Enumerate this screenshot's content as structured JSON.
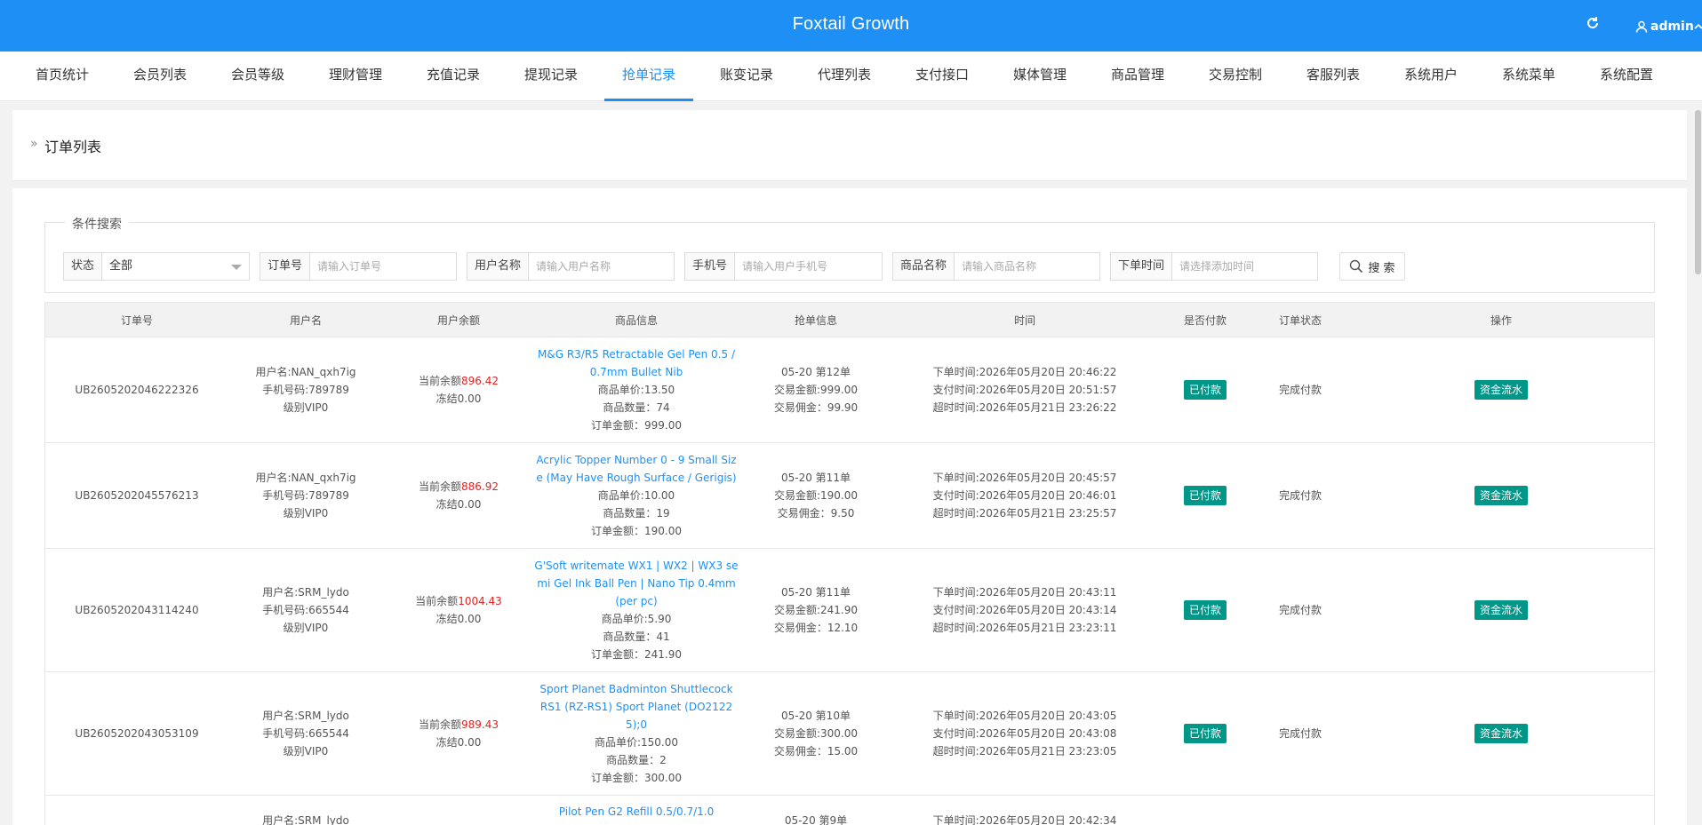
{
  "app": {
    "title": "Foxtail Growth",
    "user": "admin"
  },
  "nav": [
    {
      "label": "首页统计"
    },
    {
      "label": "会员列表"
    },
    {
      "label": "会员等级"
    },
    {
      "label": "理财管理"
    },
    {
      "label": "充值记录"
    },
    {
      "label": "提现记录"
    },
    {
      "label": "抢单记录",
      "active": true
    },
    {
      "label": "账变记录"
    },
    {
      "label": "代理列表"
    },
    {
      "label": "支付接口"
    },
    {
      "label": "媒体管理"
    },
    {
      "label": "商品管理"
    },
    {
      "label": "交易控制"
    },
    {
      "label": "客服列表"
    },
    {
      "label": "系统用户"
    },
    {
      "label": "系统菜单"
    },
    {
      "label": "系统配置"
    }
  ],
  "page": {
    "chevron": "»",
    "title": "订单列表"
  },
  "search": {
    "legend": "条件搜索",
    "status_label": "状态",
    "status_value": "全部",
    "order_label": "订单号",
    "order_placeholder": "请输入订单号",
    "username_label": "用户名称",
    "username_placeholder": "请输入用户名称",
    "phone_label": "手机号",
    "phone_placeholder": "请输入用户手机号",
    "goods_label": "商品名称",
    "goods_placeholder": "请输入商品名称",
    "time_label": "下单时间",
    "time_placeholder": "请选择添加时间",
    "button": "搜 索"
  },
  "table": {
    "headers": [
      "订单号",
      "用户名",
      "用户余额",
      "商品信息",
      "抢单信息",
      "时间",
      "是否付款",
      "订单状态",
      "操作"
    ],
    "rows": [
      {
        "order_no": "UB2605202046222326",
        "username": "用户名:NAN_qxh7ig",
        "phone": "手机号码:789789",
        "level": "级别VIP0",
        "balance_prefix": "当前余额",
        "balance": "896.42",
        "frozen": "冻结0.00",
        "goods_name_1": "M&G R3/R5 Retractable Gel Pen 0.5 /",
        "goods_name_2": "0.7mm Bullet Nib",
        "goods_name_3": "",
        "unit_price": "商品单价:13.50",
        "quantity": "商品数量：74",
        "amount": "订单金额：999.00",
        "grab_1": "05-20 第12单",
        "grab_2": "交易金额:999.00",
        "grab_3": "交易佣金：99.90",
        "time_order": "下单时间:2026年05月20日 20:46:22",
        "time_pay": "支付时间:2026年05月20日 20:51:57",
        "time_expire": "超时时间:2026年05月21日 23:26:22",
        "paid": "已付款",
        "status": "完成付款",
        "action": "资金流水"
      },
      {
        "order_no": "UB2605202045576213",
        "username": "用户名:NAN_qxh7ig",
        "phone": "手机号码:789789",
        "level": "级别VIP0",
        "balance_prefix": "当前余额",
        "balance": "886.92",
        "frozen": "冻结0.00",
        "goods_name_1": "Acrylic Topper Number 0 - 9 Small Siz",
        "goods_name_2": "e (May Have Rough Surface / Gerigis)",
        "goods_name_3": "",
        "unit_price": "商品单价:10.00",
        "quantity": "商品数量：19",
        "amount": "订单金额：190.00",
        "grab_1": "05-20 第11单",
        "grab_2": "交易金额:190.00",
        "grab_3": "交易佣金：9.50",
        "time_order": "下单时间:2026年05月20日 20:45:57",
        "time_pay": "支付时间:2026年05月20日 20:46:01",
        "time_expire": "超时时间:2026年05月21日 23:25:57",
        "paid": "已付款",
        "status": "完成付款",
        "action": "资金流水"
      },
      {
        "order_no": "UB2605202043114240",
        "username": "用户名:SRM_lydo",
        "phone": "手机号码:665544",
        "level": "级别VIP0",
        "balance_prefix": "当前余额",
        "balance": "1004.43",
        "frozen": "冻结0.00",
        "goods_name_1": "G'Soft writemate WX1 | WX2 | WX3 se",
        "goods_name_2": "mi Gel Ink Ball Pen | Nano Tip 0.4mm",
        "goods_name_3": "(per pc)",
        "unit_price": "商品单价:5.90",
        "quantity": "商品数量：41",
        "amount": "订单金额：241.90",
        "grab_1": "05-20 第11单",
        "grab_2": "交易金额:241.90",
        "grab_3": "交易佣金：12.10",
        "time_order": "下单时间:2026年05月20日 20:43:11",
        "time_pay": "支付时间:2026年05月20日 20:43:14",
        "time_expire": "超时时间:2026年05月21日 23:23:11",
        "paid": "已付款",
        "status": "完成付款",
        "action": "资金流水"
      },
      {
        "order_no": "UB2605202043053109",
        "username": "用户名:SRM_lydo",
        "phone": "手机号码:665544",
        "level": "级别VIP0",
        "balance_prefix": "当前余额",
        "balance": "989.43",
        "frozen": "冻结0.00",
        "goods_name_1": "Sport Planet Badminton Shuttlecock",
        "goods_name_2": "RS1 (RZ-RS1) Sport Planet (DO2122",
        "goods_name_3": "5);0",
        "unit_price": "商品单价:150.00",
        "quantity": "商品数量：2",
        "amount": "订单金额：300.00",
        "grab_1": "05-20 第10单",
        "grab_2": "交易金额:300.00",
        "grab_3": "交易佣金：15.00",
        "time_order": "下单时间:2026年05月20日 20:43:05",
        "time_pay": "支付时间:2026年05月20日 20:43:08",
        "time_expire": "超时时间:2026年05月21日 23:23:05",
        "paid": "已付款",
        "status": "完成付款",
        "action": "资金流水"
      },
      {
        "username": "用户名:SRM_lydo",
        "goods_name_1": "Pilot Pen G2 Refill 0.5/0.7/1.0",
        "grab_1": "05-20 第9单",
        "time_order": "下单时间:2026年05月20日 20:42:34"
      }
    ]
  }
}
